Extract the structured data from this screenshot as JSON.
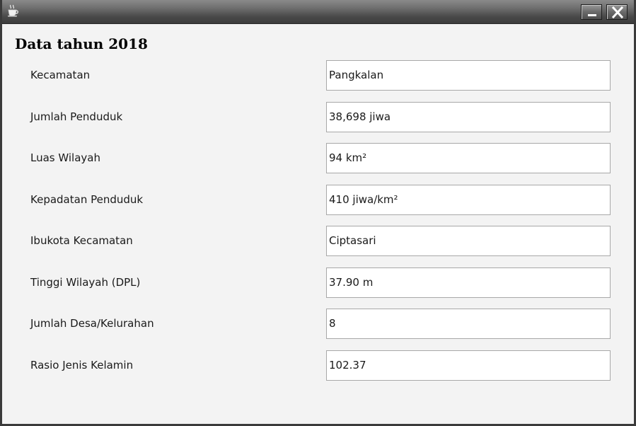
{
  "window": {
    "icon": "java-coffee-cup-icon",
    "controls": {
      "minimize_icon": "minimize-icon",
      "close_icon": "close-icon"
    }
  },
  "heading": "Data tahun 2018",
  "rows": [
    {
      "label": "Kecamatan",
      "value": "Pangkalan"
    },
    {
      "label": "Jumlah Penduduk",
      "value": "38,698 jiwa"
    },
    {
      "label": "Luas Wilayah",
      "value": "94 km²"
    },
    {
      "label": "Kepadatan Penduduk",
      "value": "410 jiwa/km²"
    },
    {
      "label": "Ibukota Kecamatan",
      "value": "Ciptasari"
    },
    {
      "label": "Tinggi Wilayah (DPL)",
      "value": "37.90 m"
    },
    {
      "label": "Jumlah Desa/Kelurahan",
      "value": "8"
    },
    {
      "label": "Rasio Jenis Kelamin",
      "value": "102.37"
    }
  ]
}
